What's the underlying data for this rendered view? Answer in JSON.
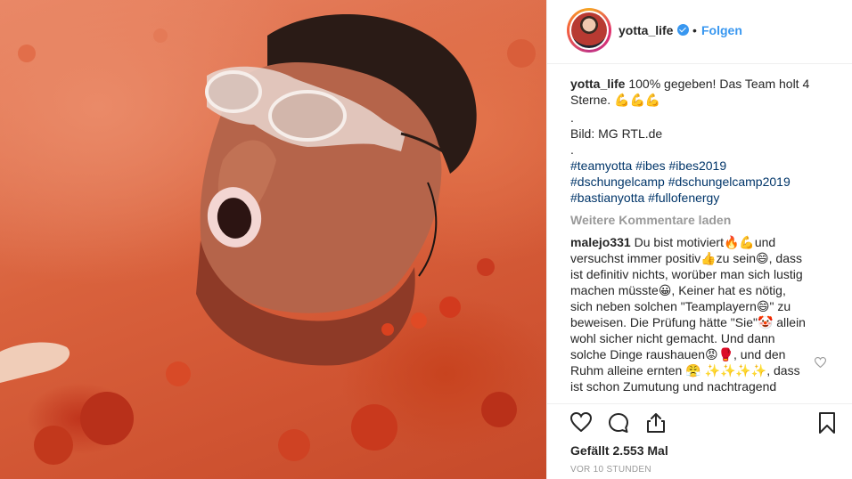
{
  "post": {
    "photo_alt": "photo"
  },
  "header": {
    "username": "yotta_life",
    "separator": "•",
    "follow_label": "Folgen"
  },
  "caption": {
    "username": "yotta_life",
    "text": "100% gegeben! Das Team holt 4 Sterne. 💪💪💪",
    "dot1": ".",
    "credit": "Bild: MG RTL.de",
    "dot2": ".",
    "hashtags_line1": "#teamyotta #ibes #ibes2019",
    "hashtags_line2": "#dschungelcamp #dschungelcamp2019",
    "hashtags_line3": "#bastianyotta #fullofenergy"
  },
  "load_more": "Weitere Kommentare laden",
  "comment": {
    "username": "malejo331",
    "text": "Du bist motiviert🔥💪und versuchst immer positiv👍zu sein😄, dass ist definitiv nichts, worüber man sich lustig machen müsste😀, Keiner hat es nötig, sich neben solchen \"Teamplayern😄\" zu beweisen. Die Prüfung hätte \"Sie\"🤡 allein wohl sicher nicht gemacht. Und dann solche Dinge raushauen😡🥊, und den Ruhm alleine ernten 😤 ✨✨✨✨, dass ist schon Zumutung und nachtragend"
  },
  "actions": {
    "like_icon": "heart-icon",
    "comment_icon": "comment-icon",
    "share_icon": "share-icon",
    "save_icon": "bookmark-icon"
  },
  "likes": "Gefällt 2.553 Mal",
  "timestamp": "VOR 10 STUNDEN",
  "colors": {
    "link_blue": "#3897f0",
    "hashtag": "#003569",
    "muted": "#999999",
    "text": "#262626",
    "verified": "#3897f0"
  }
}
